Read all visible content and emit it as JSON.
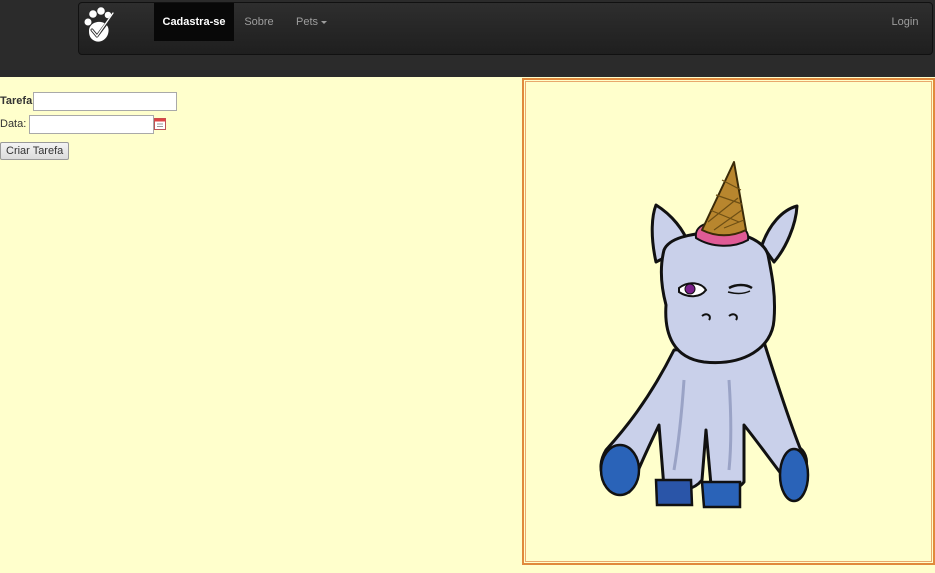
{
  "navbar": {
    "brand_icon": "paw-check-icon",
    "items": [
      {
        "label": "Cadastra-se",
        "active": true
      },
      {
        "label": "Sobre",
        "active": false
      },
      {
        "label": "Pets",
        "dropdown": true
      }
    ],
    "login_label": "Login"
  },
  "form": {
    "task_label": "Tarefa",
    "task_value": "",
    "date_label": "Data:",
    "date_value": "",
    "date_icon": "calendar-icon",
    "submit_label": "Criar Tarefa"
  },
  "pet_image": {
    "subject": "unicorn-illustration"
  },
  "colors": {
    "page_background": "#ffffcc",
    "navbar_background": "#222222",
    "frame_border": "#e08a3c"
  }
}
